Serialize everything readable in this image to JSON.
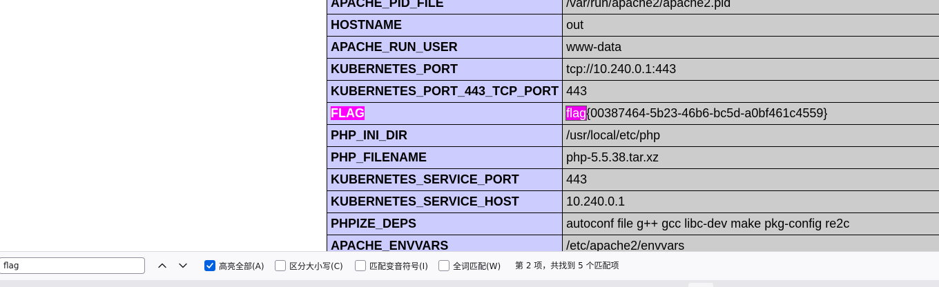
{
  "env_table": {
    "rows": [
      {
        "key": "APACHE_PID_FILE",
        "value": "/var/run/apache2/apache2.pid"
      },
      {
        "key": "HOSTNAME",
        "value": "out"
      },
      {
        "key": "APACHE_RUN_USER",
        "value": "www-data"
      },
      {
        "key": "KUBERNETES_PORT",
        "value": "tcp://10.240.0.1:443"
      },
      {
        "key": "KUBERNETES_PORT_443_TCP_PORT",
        "value": "443"
      },
      {
        "key_highlight": "FLAG",
        "value_highlight": "flag",
        "value_rest": "{00387464-5b23-46b6-bc5d-a0bf461c4559}"
      },
      {
        "key": "PHP_INI_DIR",
        "value": "/usr/local/etc/php"
      },
      {
        "key": "PHP_FILENAME",
        "value": "php-5.5.38.tar.xz"
      },
      {
        "key": "KUBERNETES_SERVICE_PORT",
        "value": "443"
      },
      {
        "key": "KUBERNETES_SERVICE_HOST",
        "value": "10.240.0.1"
      },
      {
        "key": "PHPIZE_DEPS",
        "value": "autoconf file g++ gcc libc-dev make pkg-config re2c"
      },
      {
        "key": "APACHE_ENVVARS",
        "value": "/etc/apache2/envvars"
      }
    ]
  },
  "find_bar": {
    "query": "flag",
    "prev_icon": "chevron-up-icon",
    "next_icon": "chevron-down-icon",
    "highlight_all_label": "高亮全部(A)",
    "highlight_all_checked": true,
    "match_case_label": "区分大小写(C)",
    "match_case_checked": false,
    "match_diacritics_label": "匹配变音符号(I)",
    "match_diacritics_checked": false,
    "whole_words_label": "全词匹配(W)",
    "whole_words_checked": false,
    "status": "第 2 项，共找到 5 个匹配项"
  },
  "colors": {
    "key_cell": "#ccccff",
    "value_cell": "#cccccc",
    "match_highlight": "#ff00ff",
    "checkbox_accent": "#0061e0"
  }
}
